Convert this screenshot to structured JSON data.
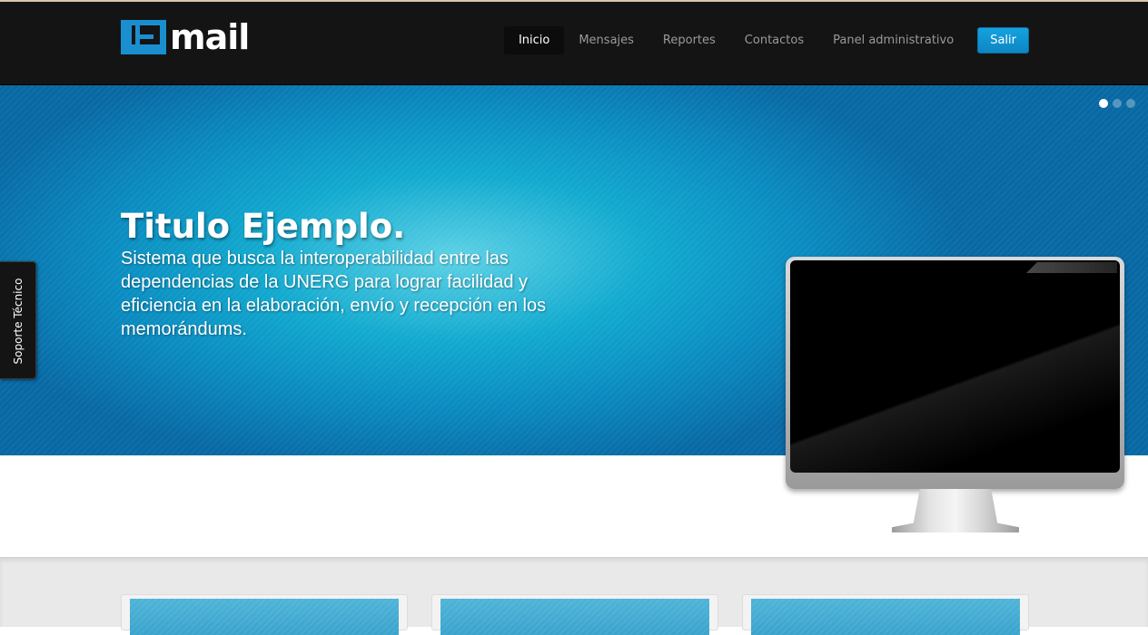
{
  "header": {
    "logo_text": "mail",
    "nav": [
      {
        "label": "Inicio",
        "active": true
      },
      {
        "label": "Mensajes",
        "active": false
      },
      {
        "label": "Reportes",
        "active": false
      },
      {
        "label": "Contactos",
        "active": false
      },
      {
        "label": "Panel administrativo",
        "active": false
      }
    ],
    "logout_label": "Salir"
  },
  "hero": {
    "title": "Titulo Ejemplo.",
    "description": "Sistema que busca la interoperabilidad entre las dependencias de la UNERG para lograr facilidad y eficiencia en la elaboración, envío y recepción en los memorándums.",
    "slides_total": 3,
    "slide_active": 1
  },
  "side_tab": {
    "label": "Soporte Técnico"
  },
  "colors": {
    "brand_blue": "#0d86c3",
    "navbar_bg": "#141414",
    "hero_blue": "#0a8cc1"
  },
  "icons": {
    "logo": "e-logo-icon",
    "monitor": "monitor-illustration"
  }
}
